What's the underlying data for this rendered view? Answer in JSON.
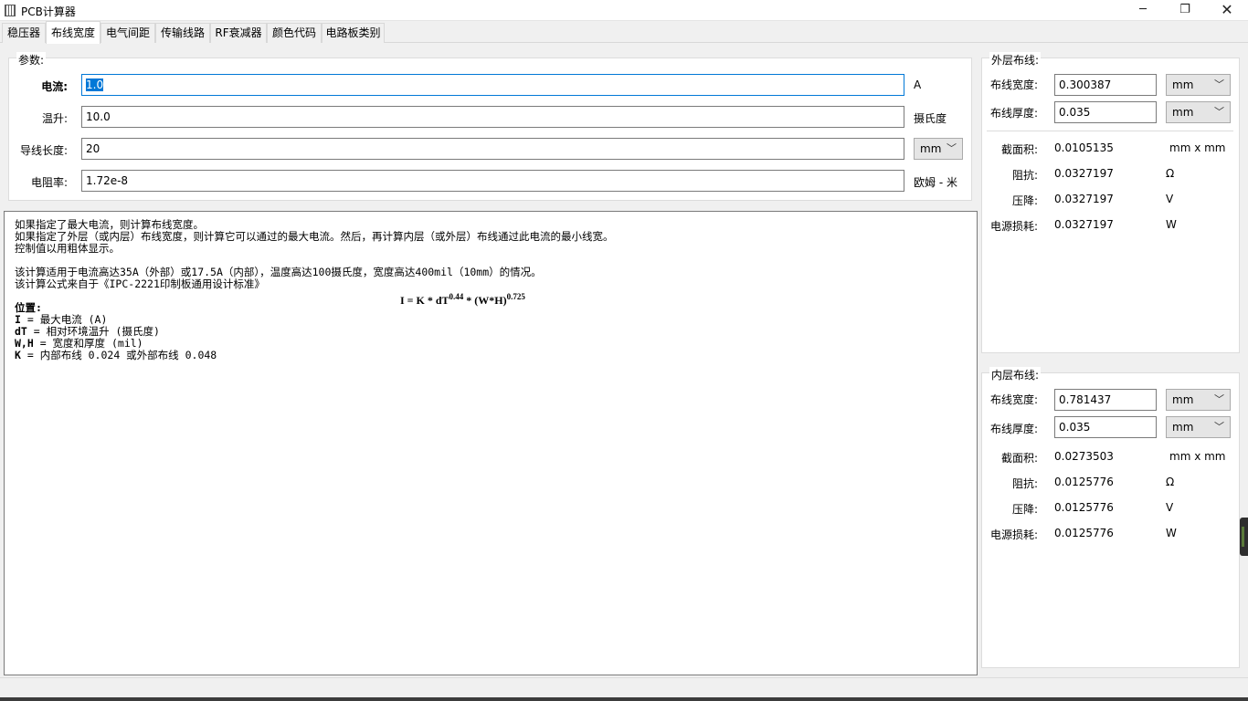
{
  "window": {
    "title": "PCB计算器",
    "min": "─",
    "max": "❐",
    "close": "✕"
  },
  "tabs": [
    "稳压器",
    "布线宽度",
    "电气间距",
    "传输线路",
    "RF衰减器",
    "颜色代码",
    "电路板类别"
  ],
  "params": {
    "group_title": "参数:",
    "current": {
      "label": "电流:",
      "value": "1.0",
      "unit": "A"
    },
    "temp_rise": {
      "label": "温升:",
      "value": "10.0",
      "unit": "摄氏度"
    },
    "conductor_length": {
      "label": "导线长度:",
      "value": "20",
      "unit": "mm"
    },
    "resistivity": {
      "label": "电阻率:",
      "value": "1.72e-8",
      "unit": "欧姆 - 米"
    }
  },
  "description": {
    "lines": [
      "如果指定了最大电流，则计算布线宽度。",
      "如果指定了外层（或内层）布线宽度，则计算它可以通过的最大电流。然后，再计算内层（或外层）布线通过此电流的最小线宽。",
      "控制值以用粗体显示。",
      "",
      "该计算适用于电流高达35A（外部）或17.5A（内部），温度高达100摄氏度，宽度高达400mil（10mm）的情况。",
      "该计算公式来自于《IPC-2221印制板通用设计标准》"
    ],
    "formula": {
      "main": "I = K * dT",
      "exp1": "0.44",
      "mid": " * (W*H)",
      "exp2": "0.725"
    },
    "where_title": "位置:",
    "defs": [
      {
        "sym": "I",
        "text": " = 最大电流 (A)"
      },
      {
        "sym": "dT",
        "text": " = 相对环境温升 (摄氏度)"
      },
      {
        "sym": "W,H",
        "text": " = 宽度和厚度 (mil)"
      },
      {
        "sym": "K",
        "text": " = 内部布线 0.024 或外部布线 0.048"
      }
    ]
  },
  "external": {
    "group_title": "外层布线:",
    "width": {
      "label": "布线宽度:",
      "value": "0.300387",
      "unit": "mm"
    },
    "thickness": {
      "label": "布线厚度:",
      "value": "0.035",
      "unit": "mm"
    },
    "area": {
      "label": "截面积:",
      "value": "0.0105135",
      "unit": "mm x  mm"
    },
    "resistance": {
      "label": "阻抗:",
      "value": "0.0327197",
      "unit": "Ω"
    },
    "voltage_drop": {
      "label": "压降:",
      "value": "0.0327197",
      "unit": "V"
    },
    "power_loss": {
      "label": "电源损耗:",
      "value": "0.0327197",
      "unit": "W"
    }
  },
  "internal": {
    "group_title": "内层布线:",
    "width": {
      "label": "布线宽度:",
      "value": "0.781437",
      "unit": "mm"
    },
    "thickness": {
      "label": "布线厚度:",
      "value": "0.035",
      "unit": "mm"
    },
    "area": {
      "label": "截面积:",
      "value": "0.0273503",
      "unit": "mm x  mm"
    },
    "resistance": {
      "label": "阻抗:",
      "value": "0.0125776",
      "unit": "Ω"
    },
    "voltage_drop": {
      "label": "压降:",
      "value": "0.0125776",
      "unit": "V"
    },
    "power_loss": {
      "label": "电源损耗:",
      "value": "0.0125776",
      "unit": "W"
    }
  },
  "icons": {
    "app": "pcb-app-icon",
    "dropdown": "chevron-down-icon"
  },
  "colors": {
    "focus_border": "#0078d7",
    "selection": "#0078d7",
    "background": "#f0f0f0"
  }
}
